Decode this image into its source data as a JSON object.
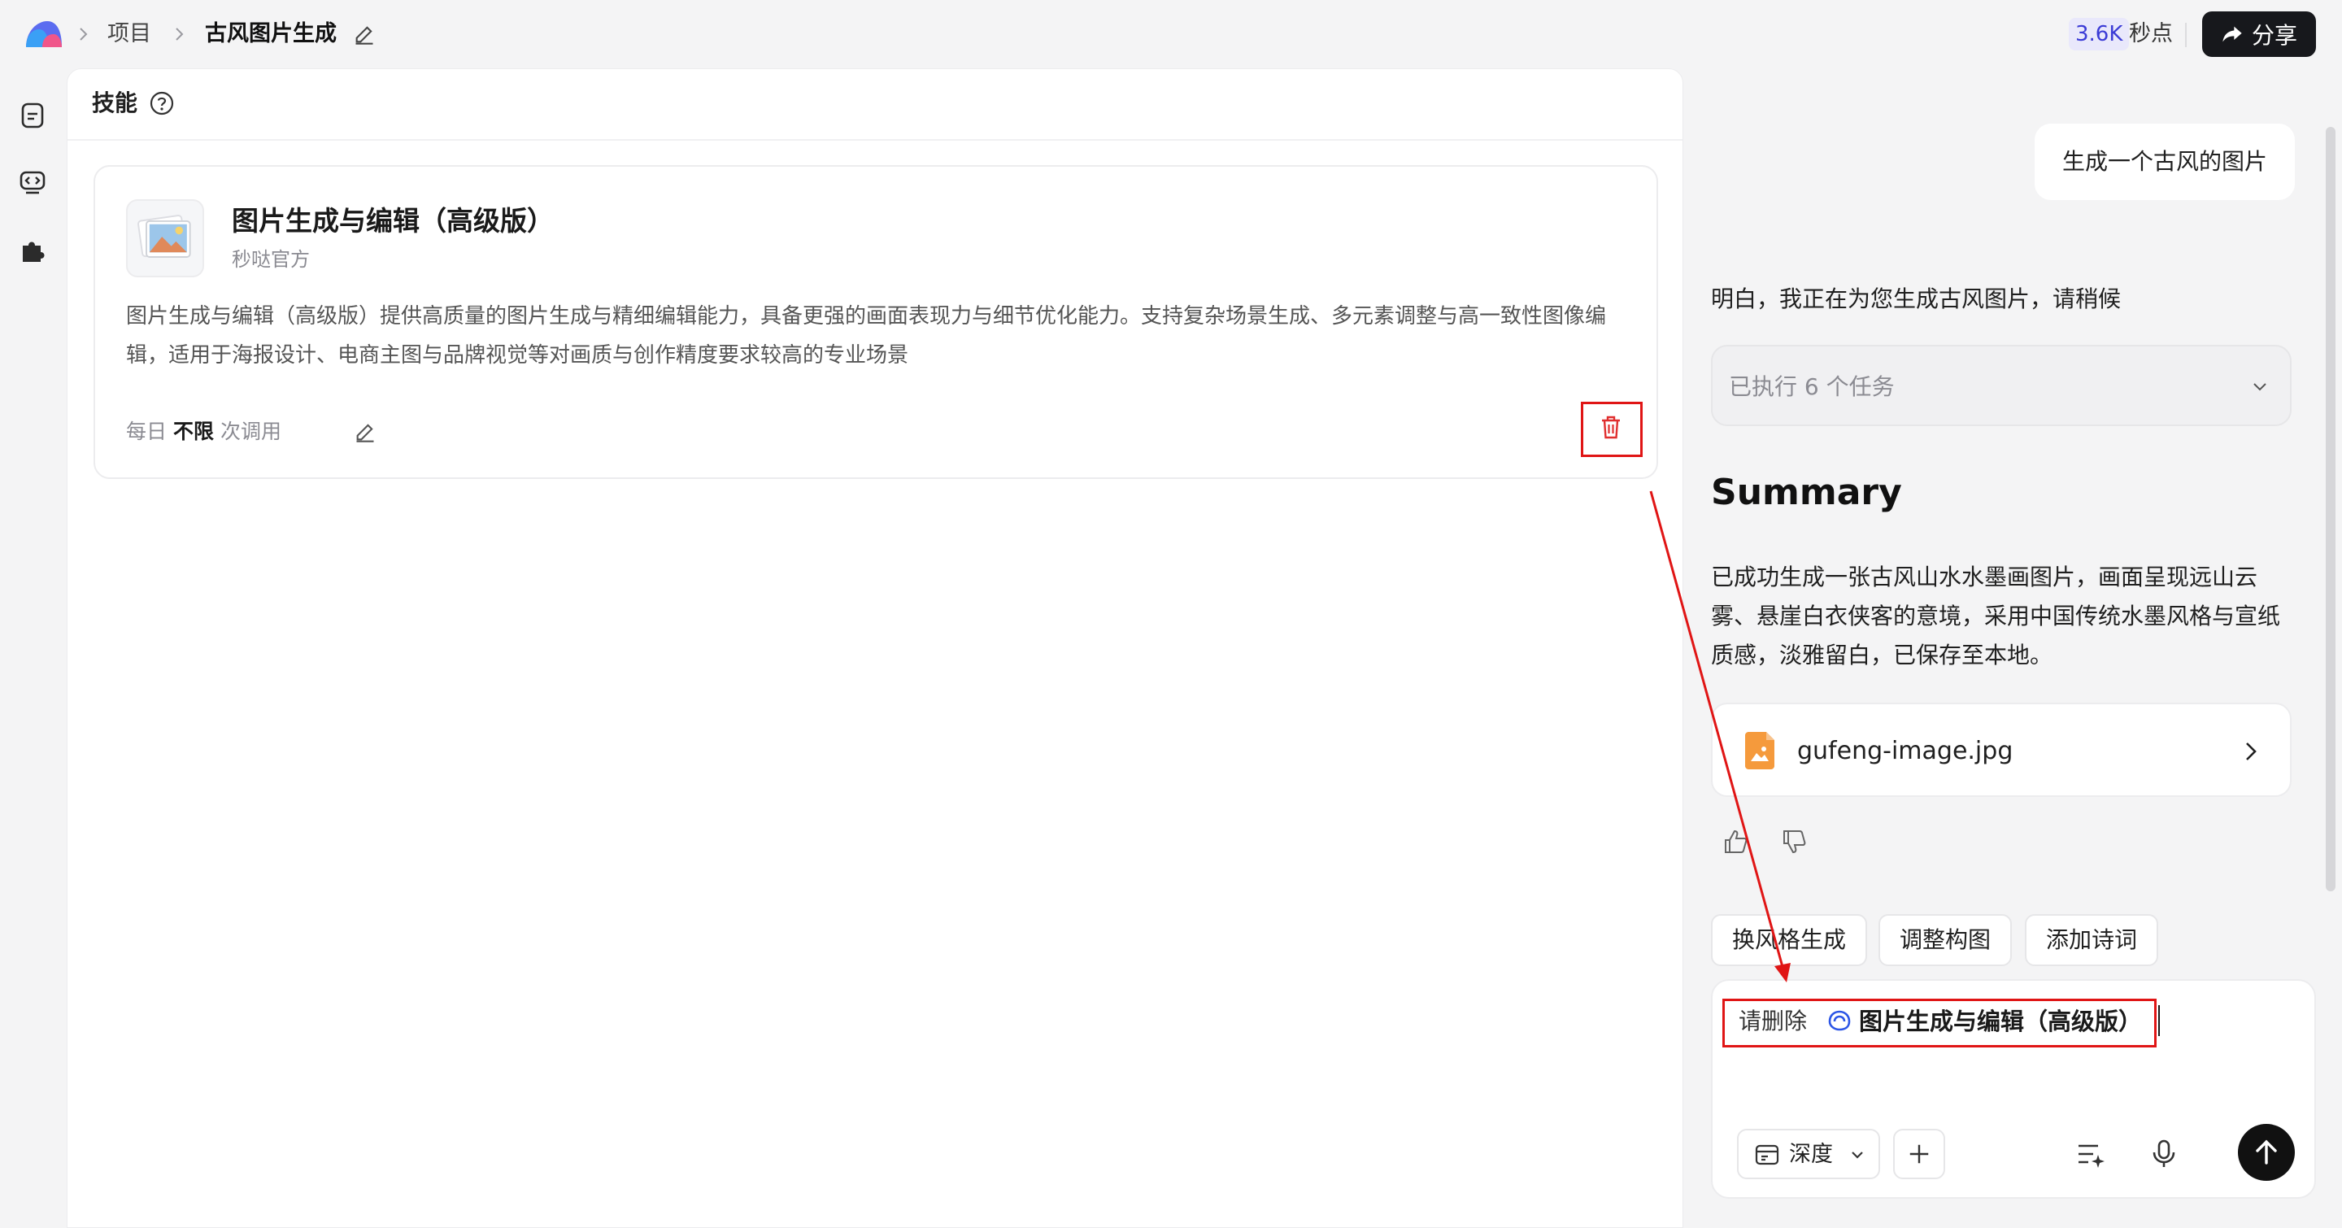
{
  "header": {
    "breadcrumb_project": "项目",
    "breadcrumb_current": "古风图片生成",
    "credits_value": "3.6K",
    "credits_label": "秒点",
    "share_label": "分享"
  },
  "skills_panel": {
    "title": "技能",
    "skill": {
      "name": "图片生成与编辑（高级版）",
      "author": "秒哒官方",
      "description": "图片生成与编辑（高级版）提供高质量的图片生成与精细编辑能力，具备更强的画面表现力与细节优化能力。支持复杂场景生成、多元素调整与高一致性图像编辑，适用于海报设计、电商主图与品牌视觉等对画质与创作精度要求较高的专业场景",
      "quota_prefix": "每日",
      "quota_value": "不限",
      "quota_suffix": "次调用"
    }
  },
  "chat": {
    "user_message": "生成一个古风的图片",
    "assistant_reply": "明白，我正在为您生成古风图片，请稍候",
    "tasks_label": "已执行 6 个任务",
    "summary_title": "Summary",
    "summary_text": "已成功生成一张古风山水水墨画图片，画面呈现远山云雾、悬崖白衣侠客的意境，采用中国传统水墨风格与宣纸质感，淡雅留白，已保存至本地。",
    "file_name": "gufeng-image.jpg",
    "suggestions": [
      "换风格生成",
      "调整构图",
      "添加诗词"
    ]
  },
  "composer": {
    "text_prefix": "请删除",
    "mention_skill": "图片生成与编辑（高级版）",
    "mode_label": "深度"
  },
  "colors": {
    "highlight": "#e01515",
    "delete_icon": "#e02e2e",
    "mention_icon": "#2b55e6",
    "credits_badge_bg": "#e9e8fb"
  }
}
